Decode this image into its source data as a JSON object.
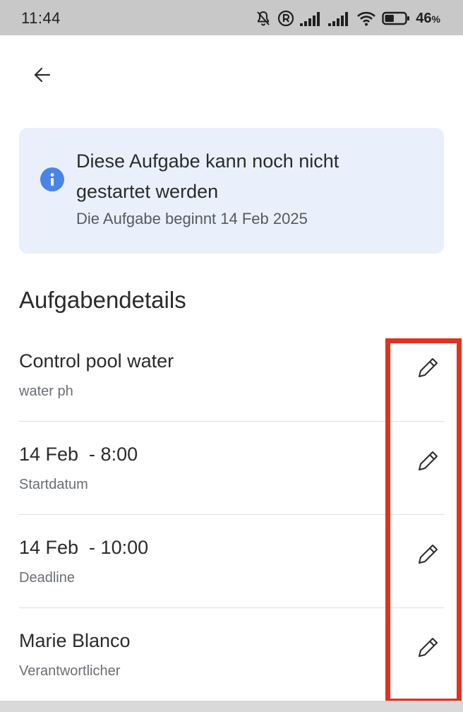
{
  "status_bar": {
    "time": "11:44",
    "battery_percent": "46",
    "battery_suffix": "%",
    "battery_level": 0.46,
    "icons": [
      "mute-icon",
      "registered-icon",
      "signal-icon",
      "signal-icon",
      "wifi-icon",
      "battery-icon"
    ]
  },
  "navigation": {
    "back_icon": "arrow-left-icon"
  },
  "info_banner": {
    "icon": "info-icon",
    "title": "Diese Aufgabe kann noch nicht gestartet werden",
    "subtitle": "Die Aufgabe beginnt 14 Feb 2025",
    "accent_color": "#4a84e8",
    "background_color": "#e9f0fb"
  },
  "section": {
    "heading": "Aufgabendetails"
  },
  "details": [
    {
      "primary": "Control pool water",
      "secondary": "water ph",
      "action_icon": "pencil-icon"
    },
    {
      "primary": "14 Feb  - 8:00",
      "secondary": "Startdatum",
      "action_icon": "pencil-icon"
    },
    {
      "primary": "14 Feb  - 10:00",
      "secondary": "Deadline",
      "action_icon": "pencil-icon"
    },
    {
      "primary": "Marie Blanco",
      "secondary": "Verantwortlicher",
      "action_icon": "pencil-icon"
    }
  ],
  "annotation": {
    "highlight_color": "#e0321f"
  }
}
